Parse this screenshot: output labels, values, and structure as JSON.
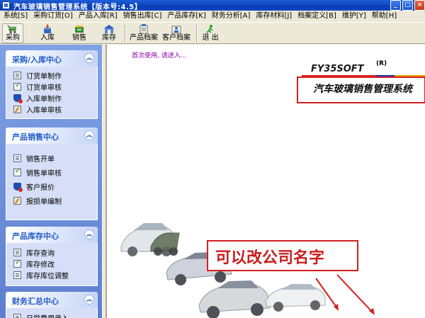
{
  "window": {
    "title": "汽车玻璃销售管理系统【版本号:4.5】",
    "minimize": "_",
    "maximize": "□",
    "close": "×"
  },
  "menu": [
    {
      "id": "system",
      "label": "系统[S]"
    },
    {
      "id": "purchase-order",
      "label": "采购订货[O]"
    },
    {
      "id": "product-in",
      "label": "产品入库[R]"
    },
    {
      "id": "sales-out",
      "label": "销售出库[C]"
    },
    {
      "id": "product-stock",
      "label": "产品库存[K]"
    },
    {
      "id": "finance",
      "label": "财务分析[A]"
    },
    {
      "id": "stock-material",
      "label": "库存材料[J]"
    },
    {
      "id": "archive",
      "label": "档案定义[B]"
    },
    {
      "id": "maintain",
      "label": "维护[Y]"
    },
    {
      "id": "help",
      "label": "帮助[H]"
    }
  ],
  "toolbar": [
    {
      "id": "purchase",
      "label": "采购",
      "icon": "cart-icon"
    },
    {
      "id": "instock",
      "label": "入库",
      "icon": "box-in-icon"
    },
    {
      "id": "sale",
      "label": "销售",
      "icon": "sale-icon"
    },
    {
      "id": "stock",
      "label": "库存",
      "icon": "warehouse-icon"
    },
    {
      "id": "product-archive",
      "label": "产品档案",
      "icon": "product-archive-icon"
    },
    {
      "id": "customer-archive",
      "label": "客户档案",
      "icon": "customer-archive-icon"
    },
    {
      "id": "exit",
      "label": "退 出",
      "icon": "exit-icon"
    }
  ],
  "sidebar": {
    "panels": [
      {
        "title": "采购/入库中心",
        "items": [
          {
            "label": "订货单制作",
            "icon": "doc"
          },
          {
            "label": "订货单审核",
            "icon": "chk"
          },
          {
            "label": "入库单制作",
            "icon": "shield"
          },
          {
            "label": "入库单审核",
            "icon": "pen"
          }
        ]
      },
      {
        "title": "产品销售中心",
        "items": [
          {
            "label": "销售开单",
            "icon": "doc"
          },
          {
            "label": "销售单审核",
            "icon": "chk"
          },
          {
            "label": "客户报价",
            "icon": "shield"
          },
          {
            "label": "报损单编制",
            "icon": "pen"
          }
        ]
      },
      {
        "title": "产品库存中心",
        "items": [
          {
            "label": "库存查询",
            "icon": "doc"
          },
          {
            "label": "库存修改",
            "icon": "chk"
          },
          {
            "label": "库存库位调整",
            "icon": "doc"
          }
        ]
      },
      {
        "title": "财务汇总中心",
        "items": [
          {
            "label": "日常费用录入",
            "icon": "doc"
          }
        ]
      }
    ],
    "chevron": "︽"
  },
  "main": {
    "hint": "首次使用, 请进入...",
    "brand": "FY35SOFT",
    "brand_sup": "(R)",
    "product_name": "汽车玻璃销售管理系统",
    "annotation": "可以改公司名字"
  },
  "colors": {
    "title_bar": "#0a3fb5",
    "sidebar_bg": "#6f8fd8",
    "panel_title": "#215dc6",
    "hint": "#8a00a8",
    "annotation_red": "#d41f1f"
  }
}
